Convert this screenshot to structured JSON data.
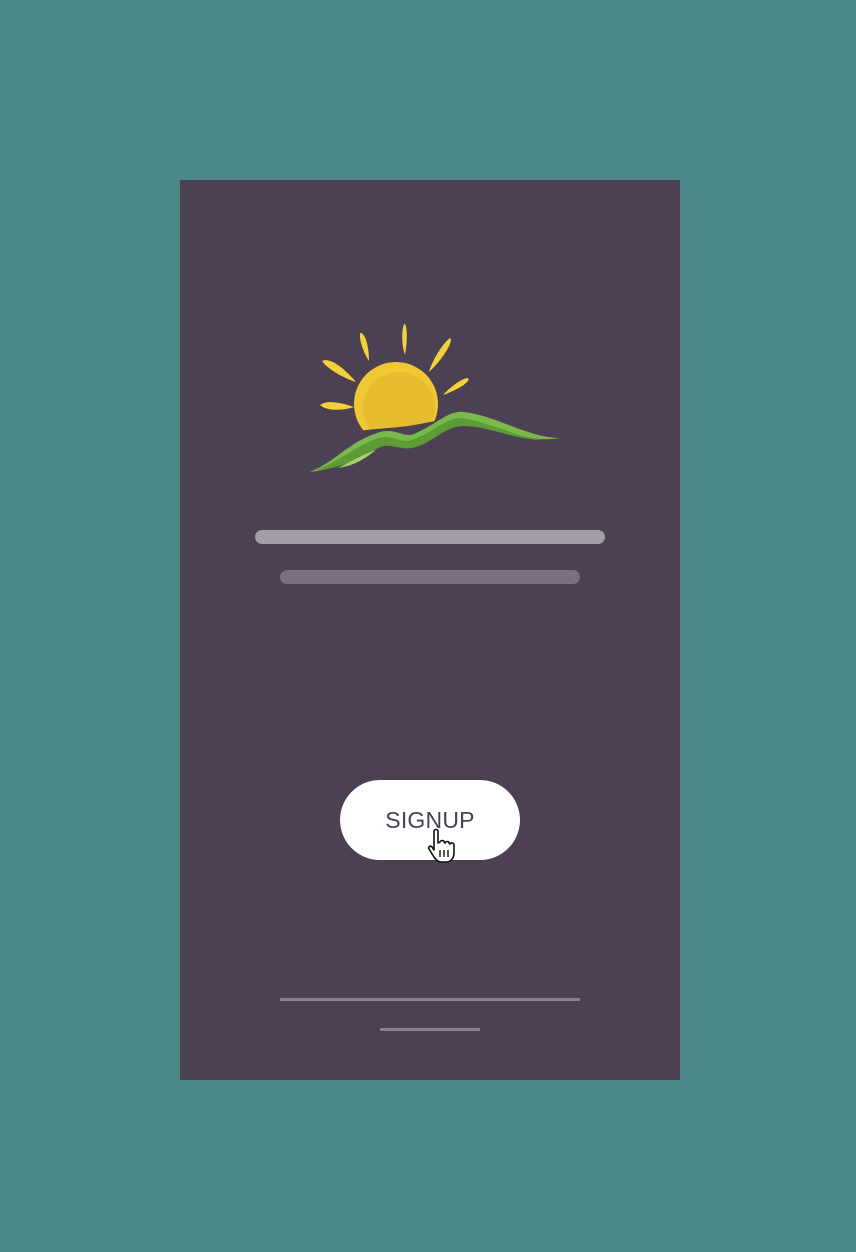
{
  "app": {
    "logo_icon": "sunrise-over-hills-logo-icon",
    "signup_label": "SIGNUP",
    "cursor_icon": "hand-pointer-icon"
  },
  "colors": {
    "page_background": "#4c8888",
    "screen_background": "#4c4053",
    "button_background": "#ffffff",
    "button_text": "#4c4053",
    "sun": "#f2c931",
    "hill": "#79b84a",
    "placeholder_bar_light": "#a49da7",
    "placeholder_bar_dark": "#7b6f80",
    "divider": "#8a7f8e"
  }
}
